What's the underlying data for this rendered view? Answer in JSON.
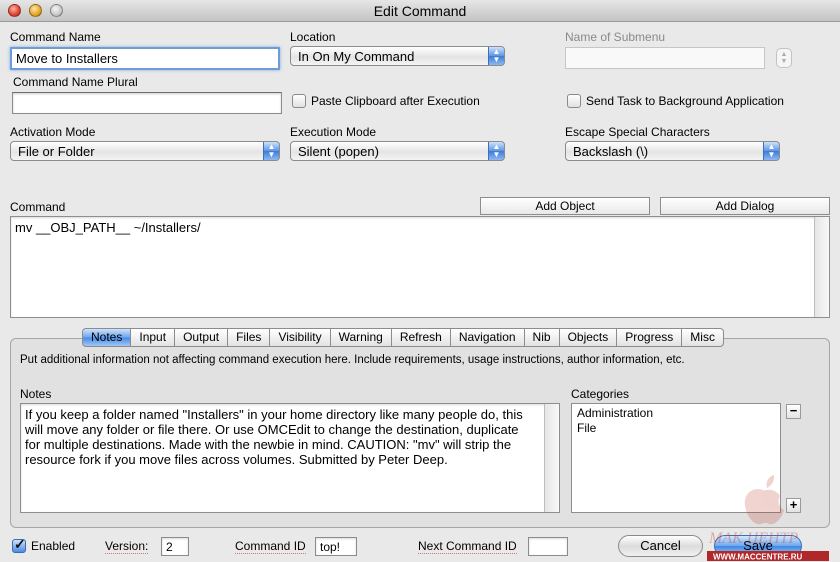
{
  "window": {
    "title": "Edit Command"
  },
  "command_name": {
    "label": "Command Name",
    "value": "Move to Installers"
  },
  "command_name_plural": {
    "label": "Command Name Plural",
    "value": ""
  },
  "location": {
    "label": "Location",
    "value": "In On My Command"
  },
  "submenu": {
    "label": "Name of Submenu",
    "value": ""
  },
  "paste_clipboard": {
    "label": "Paste Clipboard after Execution",
    "checked": false
  },
  "send_task": {
    "label": "Send Task to Background Application",
    "checked": false
  },
  "activation_mode": {
    "label": "Activation Mode",
    "value": "File or Folder"
  },
  "execution_mode": {
    "label": "Execution Mode",
    "value": "Silent (popen)"
  },
  "escape_chars": {
    "label": "Escape Special Characters",
    "value": "Backslash (\\)"
  },
  "command": {
    "label": "Command",
    "value": "mv __OBJ_PATH__ ~/Installers/",
    "add_object": "Add Object",
    "add_dialog": "Add Dialog"
  },
  "tabs": [
    {
      "label": "Notes",
      "active": true
    },
    {
      "label": "Input"
    },
    {
      "label": "Output"
    },
    {
      "label": "Files"
    },
    {
      "label": "Visibility"
    },
    {
      "label": "Warning"
    },
    {
      "label": "Refresh"
    },
    {
      "label": "Navigation"
    },
    {
      "label": "Nib"
    },
    {
      "label": "Objects"
    },
    {
      "label": "Progress"
    },
    {
      "label": "Misc"
    }
  ],
  "notes_tab": {
    "description": "Put additional information not affecting command execution here. Include requirements, usage instructions, author information, etc.",
    "notes_label": "Notes",
    "notes_text": "If you keep a folder named \"Installers\" in your home directory like many people do, this will move any folder or file there. Or use OMCEdit to change the destination, duplicate for multiple destinations. Made with the newbie in mind. CAUTION: \"mv\" will strip the resource fork if you move files across volumes. Submitted by Peter Deep.",
    "categories_label": "Categories",
    "categories": [
      "Administration",
      "File"
    ],
    "remove_symbol": "−",
    "add_symbol": "+"
  },
  "footer": {
    "enabled_label": "Enabled",
    "enabled_checked": true,
    "version_label": "Version:",
    "version_value": "2",
    "command_id_label": "Command ID",
    "command_id_value": "top!",
    "next_command_id_label": "Next Command ID",
    "next_command_id_value": "",
    "cancel": "Cancel",
    "save": "Save"
  },
  "watermark": {
    "line1": "МАК ЦЕНТР",
    "line2": "WWW.MACCENTRE.RU"
  }
}
